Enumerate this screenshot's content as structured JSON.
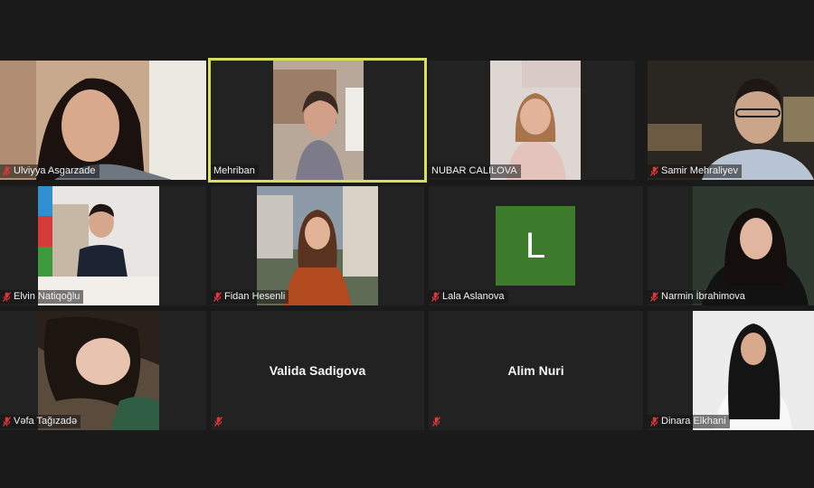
{
  "participants": [
    {
      "name": "Ulviyya Asgarzade"
    },
    {
      "name": "Mehriban"
    },
    {
      "name": "NUBAR CALILOVA"
    },
    {
      "name": "Samir Mehraliyev"
    },
    {
      "name": "Elvin Natiqoğlu"
    },
    {
      "name": "Fidan Hesenli"
    },
    {
      "name": "Lala Aslanova",
      "avatar_letter": "L"
    },
    {
      "name": "Narmin İbrahimova"
    },
    {
      "name": "Vəfa Tağızadə"
    },
    {
      "name": "Valida Sadigova"
    },
    {
      "name": "Alim Nuri"
    },
    {
      "name": "Dinara Elkhani"
    }
  ],
  "colors": {
    "background": "#1a1a1a",
    "tile_background": "#222222",
    "active_speaker_border": "#d6e05a",
    "avatar_background": "#3c7b2b",
    "muted_icon": "#e0363a"
  },
  "active_speaker": "Mehriban"
}
